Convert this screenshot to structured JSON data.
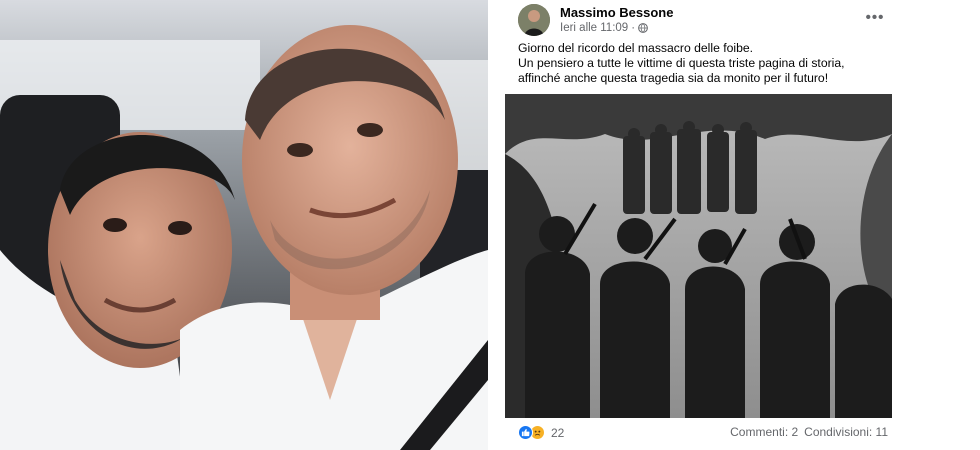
{
  "post": {
    "author": "Massimo Bessone",
    "timestamp": "Ieri alle 11:09",
    "separator": "·",
    "privacy_icon": "globe-icon",
    "more_icon": "more-horizontal-icon",
    "more_label": "•••",
    "text_lines": [
      "Giorno del ricordo del massacro delle foibe.",
      "Un pensiero a tutte le vittime di questa triste pagina di storia, affinché anche questa tragedia sia da monito per il futuro!"
    ],
    "reactions": {
      "icons": [
        "like-icon",
        "sad-icon"
      ],
      "count": "22"
    },
    "comments": "Commenti: 2",
    "shares": "Condivisioni: 11"
  },
  "colors": {
    "like_blue": "#1877f2",
    "sad_yellow": "#f7b125",
    "meta_gray": "#65676b"
  }
}
